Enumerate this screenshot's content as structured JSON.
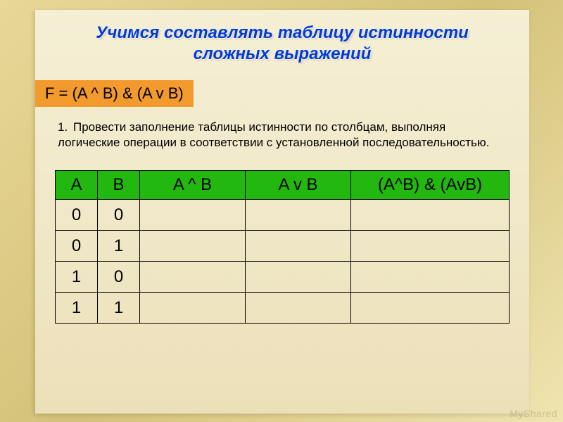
{
  "title_line1": "Учимся составлять таблицу истинности",
  "title_line2": "сложных выражений",
  "formula": "F = (A ^ B) & (A v B)",
  "instruction_num": "1.",
  "instruction_text": "Провести заполнение таблицы истинности по столбцам, выполняя логические операции в соответствии с установленной последовательностью.",
  "table": {
    "headers": [
      "A",
      "B",
      "A ^ B",
      "A v B",
      "(A^B) & (AvB)"
    ],
    "rows": [
      [
        "0",
        "0",
        "",
        "",
        ""
      ],
      [
        "0",
        "1",
        "",
        "",
        ""
      ],
      [
        "1",
        "0",
        "",
        "",
        ""
      ],
      [
        "1",
        "1",
        "",
        "",
        ""
      ]
    ]
  },
  "watermark": "MyShared"
}
